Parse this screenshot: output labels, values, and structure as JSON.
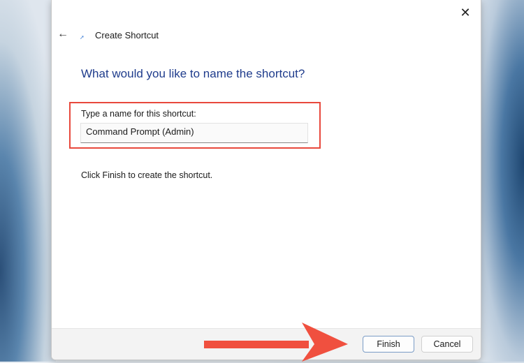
{
  "dialog": {
    "title": "Create Shortcut",
    "heading": "What would you like to name the shortcut?",
    "name_label": "Type a name for this shortcut:",
    "name_value": "Command Prompt (Admin)",
    "hint": "Click Finish to create the shortcut.",
    "close_glyph": "✕",
    "back_glyph": "←",
    "finish_label": "Finish",
    "cancel_label": "Cancel"
  },
  "colors": {
    "highlight": "#e8483c",
    "heading": "#1f3c8c"
  }
}
